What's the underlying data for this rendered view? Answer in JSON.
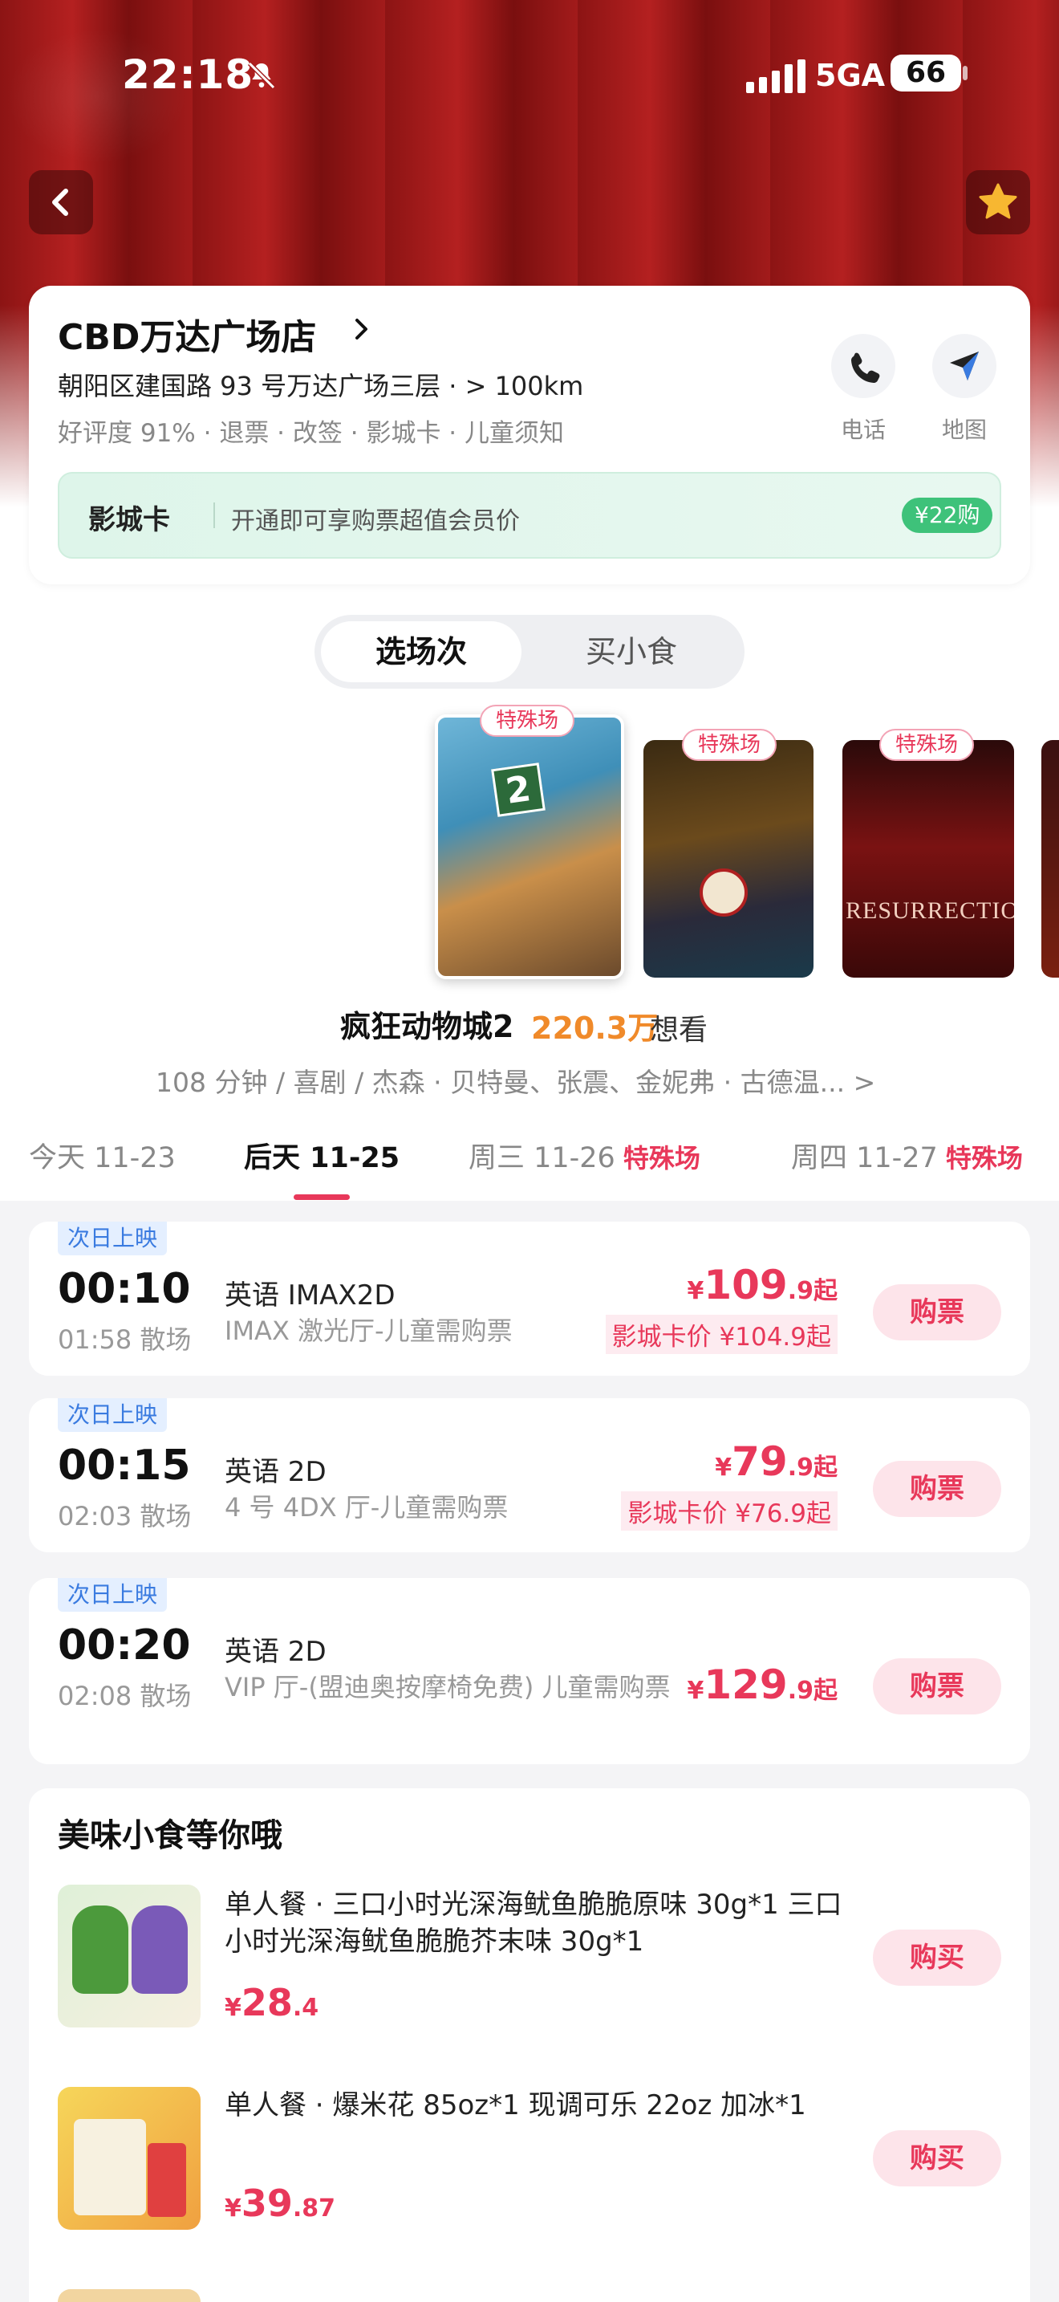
{
  "status_bar": {
    "time": "22:18",
    "network": "5GA",
    "battery": "66"
  },
  "cinema": {
    "name": "CBD万达广场店",
    "address": "朝阳区建国路 93 号万达广场三层 · > 100km",
    "tags": "好评度 91% · 退票 · 改签 · 影城卡 · 儿童须知",
    "phone_label": "电话",
    "map_label": "地图",
    "member_card": {
      "title": "影城卡",
      "desc": "开通即可享购票超值会员价",
      "button": "¥22购"
    }
  },
  "tabs": {
    "showtimes": "选场次",
    "snacks": "买小食"
  },
  "posters": {
    "badge": "特殊场"
  },
  "movie": {
    "title": "疯狂动物城2",
    "heat": "220.3万",
    "want": "想看",
    "meta": "108 分钟 / 喜剧 / 杰森 · 贝特曼、张震、金妮弗 · 古德温... >"
  },
  "dates": [
    {
      "label": "今天  11-23",
      "special": ""
    },
    {
      "label": "后天 11-25",
      "special": ""
    },
    {
      "label": "周三  11-26",
      "special": "特殊场"
    },
    {
      "label": "周四  11-27",
      "special": "特殊场"
    }
  ],
  "shows": [
    {
      "tag": "次日上映",
      "start": "00:10",
      "end": "01:58 散场",
      "lang": "英语 IMAX2D",
      "hall": "IMAX 激光厅-儿童需购票",
      "price_symbol": "¥",
      "price_int": "109",
      "price_dec": ".9起",
      "member_price": "影城卡价 ¥104.9起",
      "buy": "购票"
    },
    {
      "tag": "次日上映",
      "start": "00:15",
      "end": "02:03 散场",
      "lang": "英语 2D",
      "hall": "4 号 4DX 厅-儿童需购票",
      "price_symbol": "¥",
      "price_int": "79",
      "price_dec": ".9起",
      "member_price": "影城卡价 ¥76.9起",
      "buy": "购票"
    },
    {
      "tag": "次日上映",
      "start": "00:20",
      "end": "02:08 散场",
      "lang": "英语 2D",
      "hall": "VIP 厅-(盟迪奥按摩椅免费) 儿童需购票",
      "price_symbol": "¥",
      "price_int": "129",
      "price_dec": ".9起",
      "member_price": "",
      "buy": "购票"
    }
  ],
  "snacks": {
    "heading": "美味小食等你哦",
    "items": [
      {
        "name": "单人餐 · 三口小时光深海鱿鱼脆脆原味 30g*1 三口小时光深海鱿鱼脆脆芥末味 30g*1",
        "price_symbol": "¥",
        "price_int": "28",
        "price_dec": ".4",
        "buy": "购买"
      },
      {
        "name": "单人餐 · 爆米花 85oz*1 现调可乐 22oz 加冰*1",
        "price_symbol": "¥",
        "price_int": "39",
        "price_dec": ".87",
        "buy": "购买"
      }
    ]
  },
  "colors": {
    "accent": "#e8385a",
    "heat": "#f08a2a",
    "member_btn": "#3ec27a",
    "hero": "#a21b1b"
  },
  "icons": [
    "back-chevron-icon",
    "star-icon",
    "phone-icon",
    "navigation-arrow-icon",
    "bell-mute-icon",
    "chevron-right-icon"
  ]
}
